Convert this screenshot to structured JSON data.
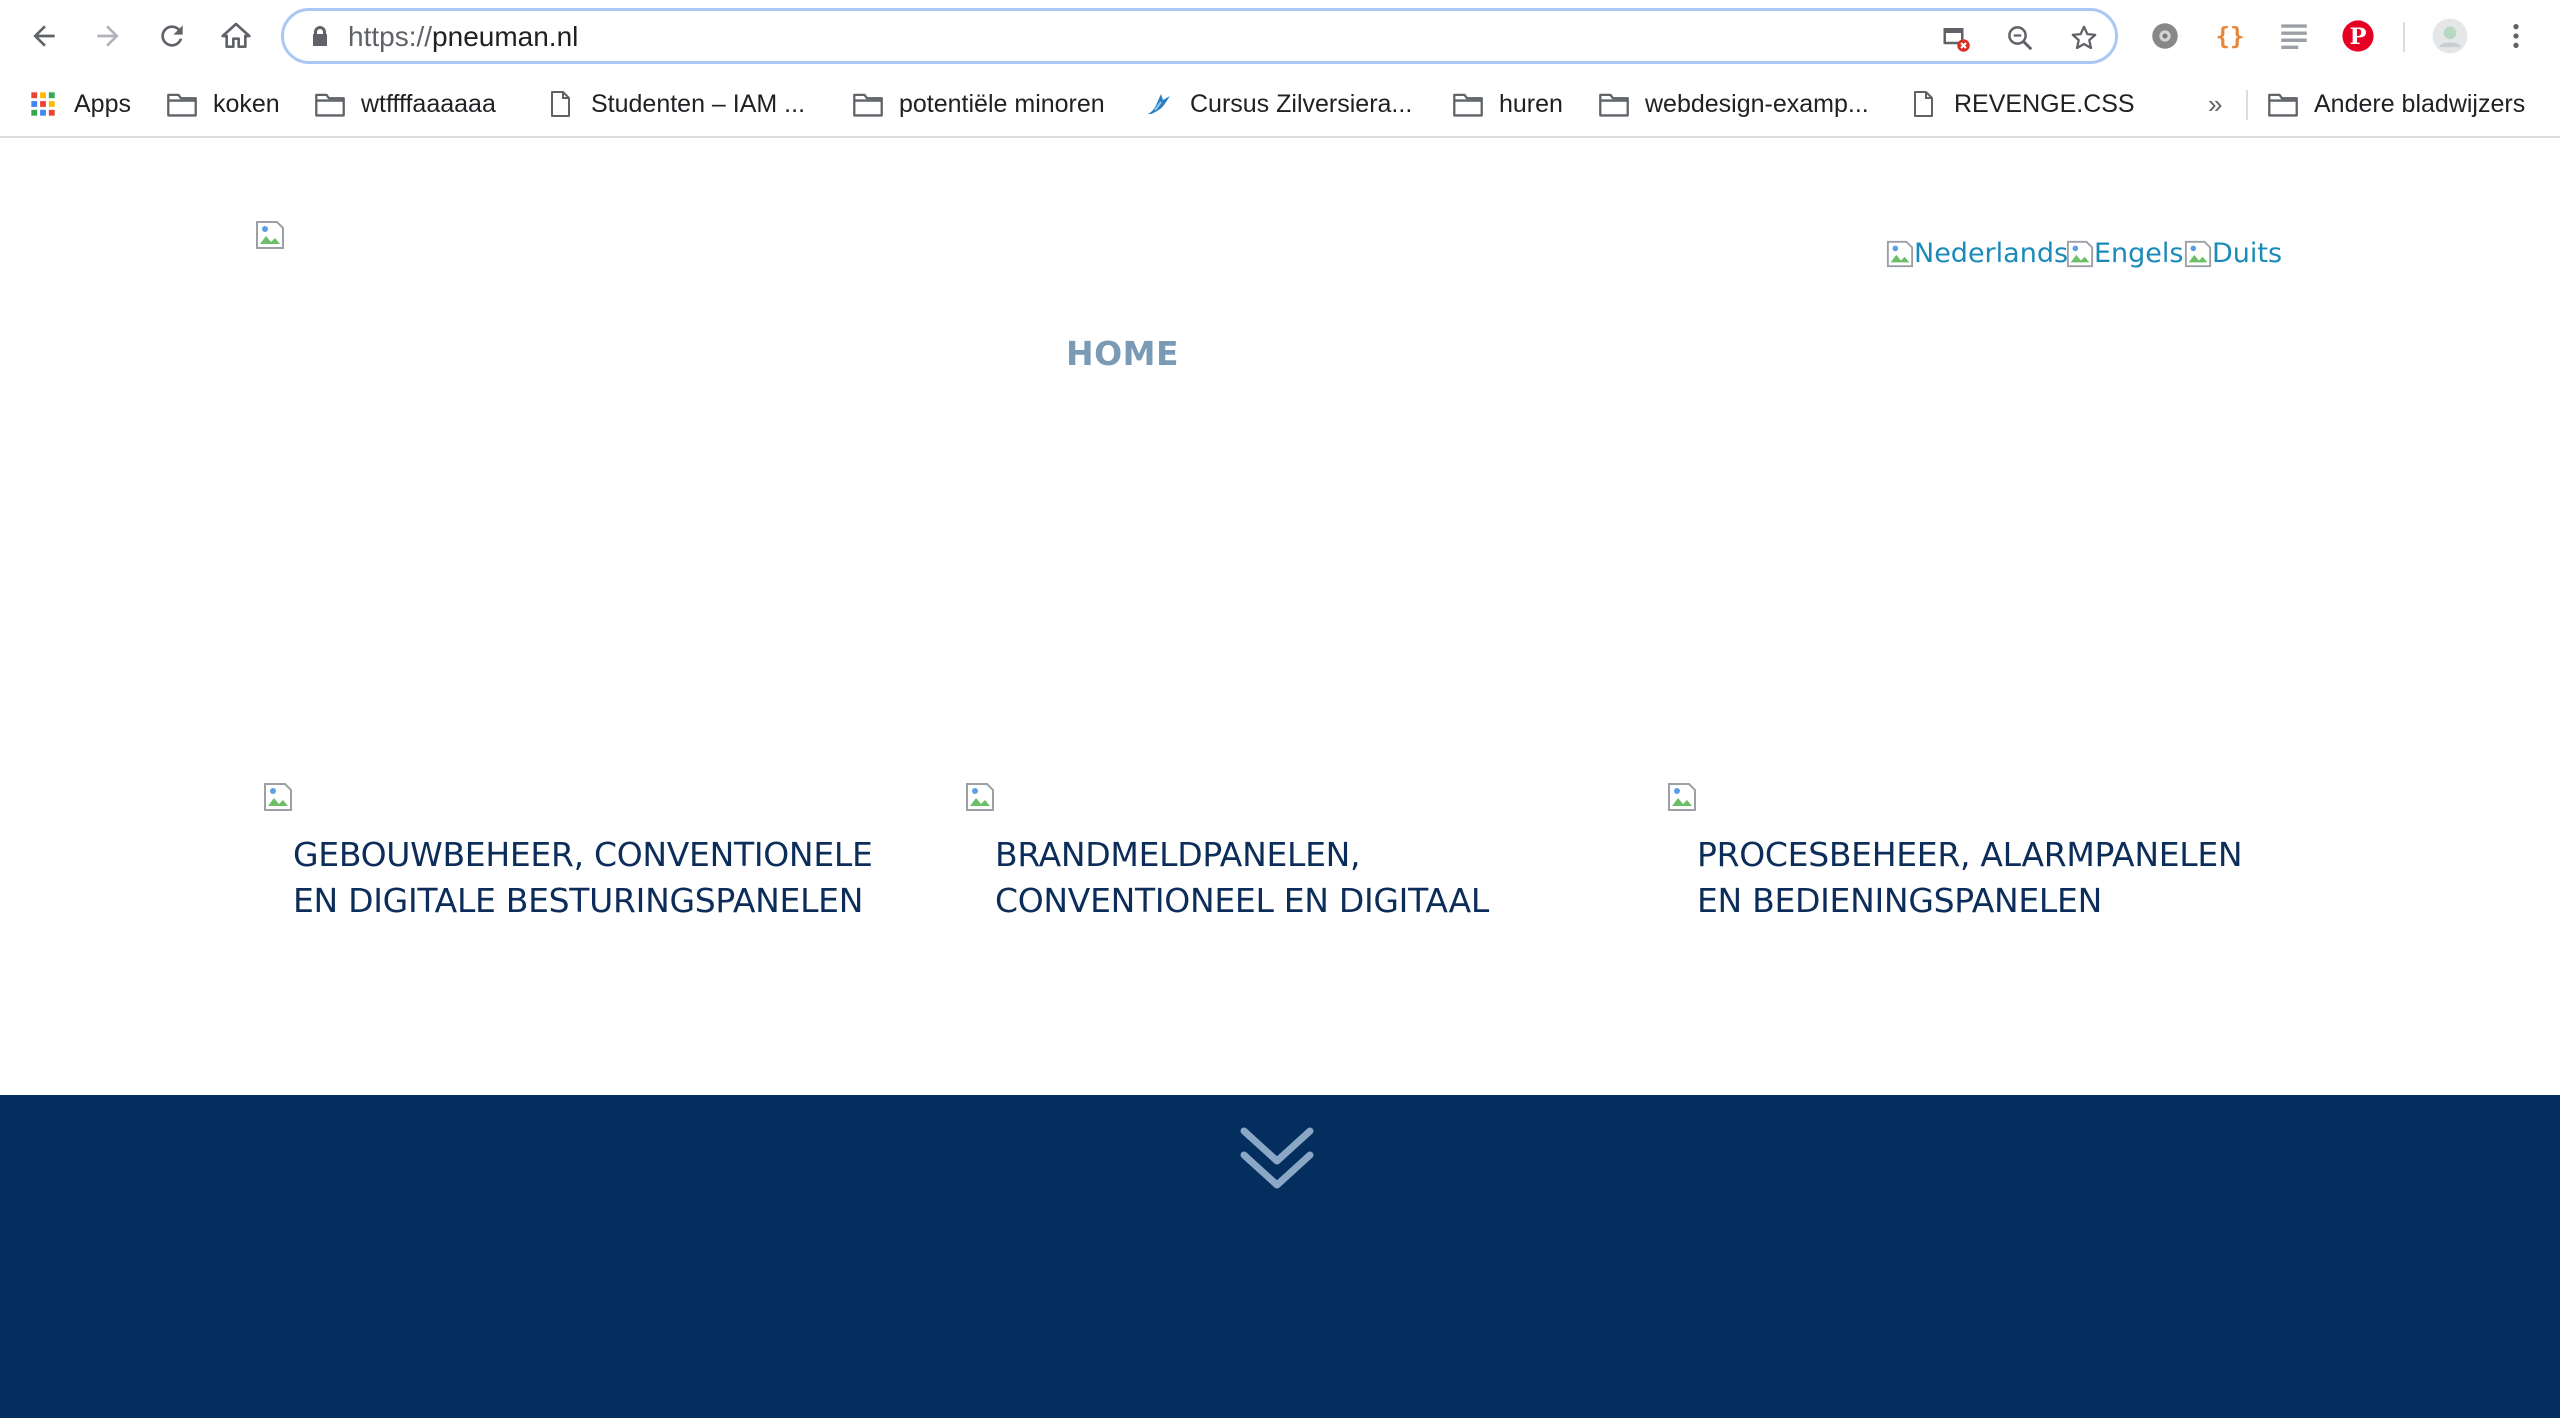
{
  "browser": {
    "url_scheme": "https://",
    "url_host": "pneuman.nl",
    "bookmarks": [
      {
        "label": "Apps",
        "icon": "apps-grid-icon"
      },
      {
        "label": "koken",
        "icon": "folder-icon"
      },
      {
        "label": "wtffffaaaaaa",
        "icon": "folder-icon"
      },
      {
        "label": "Studenten – IAM ...",
        "icon": "page-icon"
      },
      {
        "label": "potentiële minoren",
        "icon": "folder-icon"
      },
      {
        "label": "Cursus Zilversiera...",
        "icon": "bird-icon"
      },
      {
        "label": "huren",
        "icon": "folder-icon"
      },
      {
        "label": "webdesign-examp...",
        "icon": "folder-icon"
      },
      {
        "label": "REVENGE.CSS",
        "icon": "page-icon"
      }
    ],
    "overflow_label": "»",
    "other_bookmarks": "Andere bladwijzers"
  },
  "site": {
    "languages": [
      "Nederlands",
      "Engels",
      "Duits"
    ],
    "menu": {
      "home": "HOME"
    },
    "services": [
      {
        "title": "GEBOUWBEHEER, CONVENTIONELE EN DIGITALE BESTURINGSPANELEN"
      },
      {
        "title": "BRANDMELDPANELEN, CONVENTIONEEL EN DIGITAAL"
      },
      {
        "title": "PROCESBEHEER, ALARMPANELEN EN BEDIENINGSPANELEN"
      }
    ],
    "colors": {
      "footer": "#032e5d",
      "link": "#1a8bb9",
      "menu": "#7b9ab5",
      "service_title": "#0c2d5a"
    }
  }
}
